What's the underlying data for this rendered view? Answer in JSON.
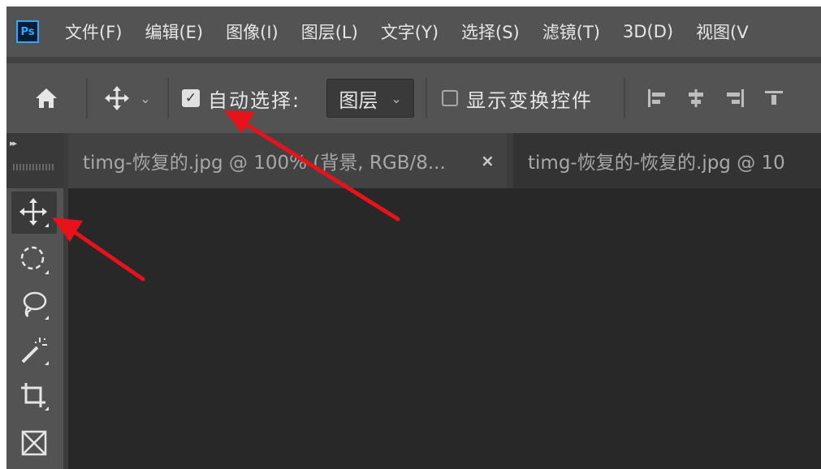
{
  "app": {
    "logo_text": "Ps",
    "menu": [
      "文件(F)",
      "编辑(E)",
      "图像(I)",
      "图层(L)",
      "文字(Y)",
      "选择(S)",
      "滤镜(T)",
      "3D(D)",
      "视图(V"
    ]
  },
  "options_bar": {
    "home_icon": "home-icon",
    "move_tool_icon": "move-icon",
    "auto_select": {
      "checked": true,
      "label": "自动选择:"
    },
    "auto_select_target": "图层",
    "show_transform_controls": {
      "checked": false,
      "label": "显示变换控件"
    },
    "align_icons": [
      "align-left-icon",
      "align-horizontal-center-icon",
      "align-right-icon",
      "align-extra-icon"
    ]
  },
  "document_tabs": [
    {
      "title": "timg-恢复的.jpg @ 100% (背景, RGB/8...",
      "close": "×",
      "active": true
    },
    {
      "title": "timg-恢复的-恢复的.jpg @ 10",
      "active": false
    }
  ],
  "toolbar": {
    "tools": [
      "move-tool",
      "elliptical-marquee-tool",
      "lasso-tool",
      "magic-wand-tool",
      "crop-tool",
      "frame-tool"
    ],
    "active_tool": "move-tool"
  },
  "colors": {
    "ui_gray": "#535353",
    "canvas": "#282828",
    "tab_active": "#424242",
    "annotation_arrow": "#e8121a",
    "ps_logo": "#31a8ff"
  }
}
